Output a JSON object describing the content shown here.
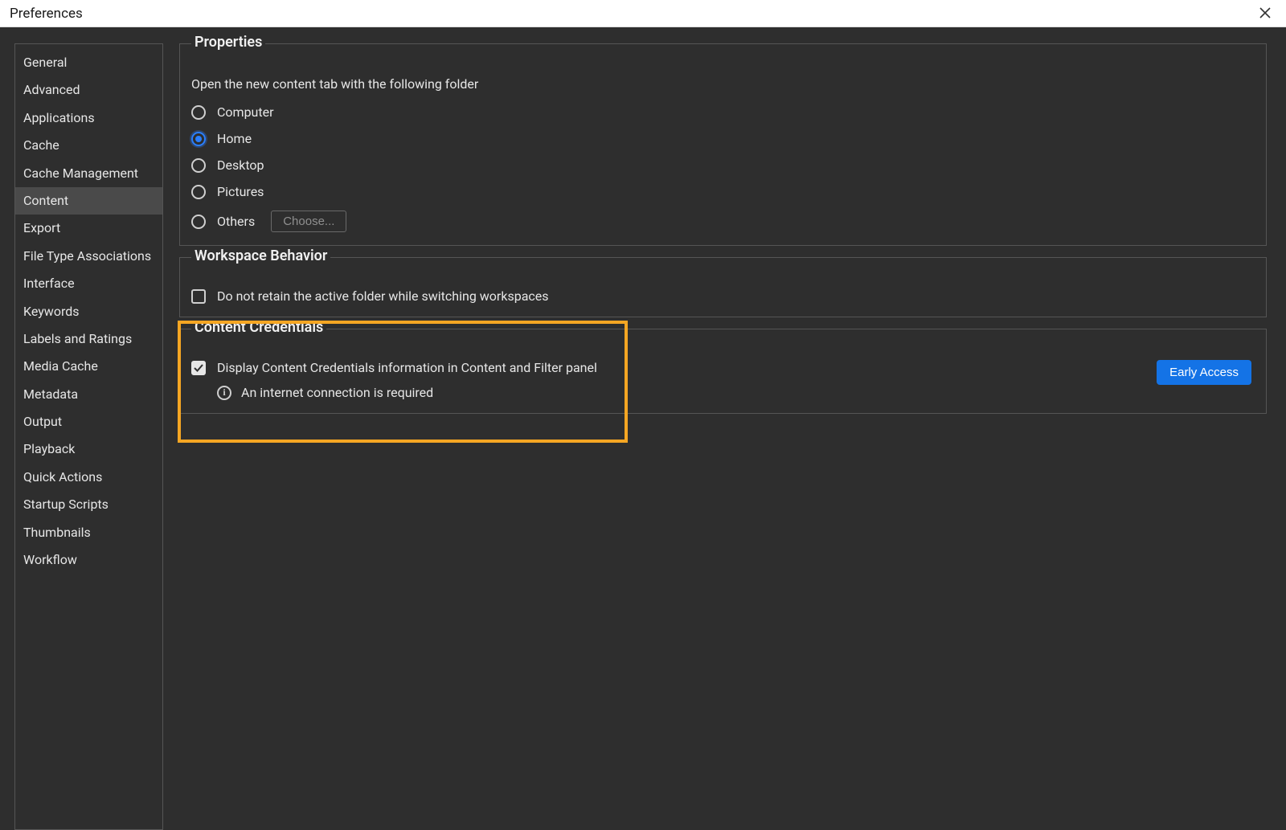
{
  "window": {
    "title": "Preferences"
  },
  "sidebar": {
    "items": [
      {
        "label": "General",
        "selected": false
      },
      {
        "label": "Advanced",
        "selected": false
      },
      {
        "label": "Applications",
        "selected": false
      },
      {
        "label": "Cache",
        "selected": false
      },
      {
        "label": "Cache Management",
        "selected": false
      },
      {
        "label": "Content",
        "selected": true
      },
      {
        "label": "Export",
        "selected": false
      },
      {
        "label": "File Type Associations",
        "selected": false
      },
      {
        "label": "Interface",
        "selected": false
      },
      {
        "label": "Keywords",
        "selected": false
      },
      {
        "label": "Labels and Ratings",
        "selected": false
      },
      {
        "label": "Media Cache",
        "selected": false
      },
      {
        "label": "Metadata",
        "selected": false
      },
      {
        "label": "Output",
        "selected": false
      },
      {
        "label": "Playback",
        "selected": false
      },
      {
        "label": "Quick Actions",
        "selected": false
      },
      {
        "label": "Startup Scripts",
        "selected": false
      },
      {
        "label": "Thumbnails",
        "selected": false
      },
      {
        "label": "Workflow",
        "selected": false
      }
    ]
  },
  "properties": {
    "legend": "Properties",
    "desc": "Open the new content tab with the following folder",
    "options": [
      {
        "label": "Computer",
        "selected": false
      },
      {
        "label": "Home",
        "selected": true
      },
      {
        "label": "Desktop",
        "selected": false
      },
      {
        "label": "Pictures",
        "selected": false
      },
      {
        "label": "Others",
        "selected": false,
        "hasChoose": true
      }
    ],
    "choose_label": "Choose..."
  },
  "workspace": {
    "legend": "Workspace Behavior",
    "checkbox_label": "Do not retain the active folder while switching workspaces",
    "checked": false
  },
  "credentials": {
    "legend": "Content Credentials",
    "checkbox_label": "Display Content Credentials information in Content and Filter panel",
    "checked": true,
    "info_text": "An internet connection is required",
    "early_access_label": "Early Access"
  }
}
